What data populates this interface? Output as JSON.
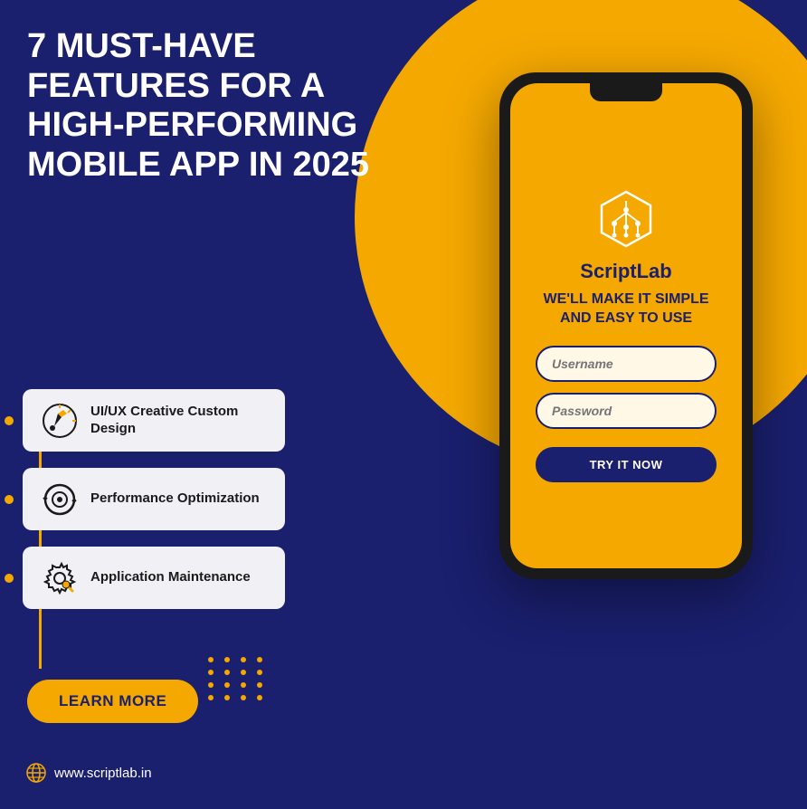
{
  "page": {
    "background_color": "#1a1f6e",
    "title": "7 Must-Have Features for a High-Performing Mobile App in 2025"
  },
  "heading": {
    "line1": "7 MUST-HAVE",
    "line2": "FEATURES FOR A",
    "line3": "HIGH-PERFORMING",
    "line4": "MOBILE APP IN",
    "line5": "2025",
    "full": "7 MUST-HAVE FEATURES FOR A HIGH-PERFORMING MOBILE APP IN 2025"
  },
  "features": [
    {
      "id": "uiux",
      "label": "UI/UX Creative Custom Design"
    },
    {
      "id": "performance",
      "label": "Performance Optimization"
    },
    {
      "id": "maintenance",
      "label": "Application Maintenance"
    }
  ],
  "buttons": {
    "learn_more": "LEARN MORE"
  },
  "footer": {
    "website": "www.scriptlab.in"
  },
  "phone": {
    "brand": "ScriptLab",
    "tagline": "WE'LL MAKE IT SIMPLE AND EASY TO USE",
    "username_placeholder": "Username",
    "password_placeholder": "Password",
    "cta_button": "TRY IT NOW"
  },
  "colors": {
    "primary_blue": "#1a1f6e",
    "accent_orange": "#f5a800",
    "white": "#ffffff",
    "light_bg": "#f0f0f5"
  }
}
